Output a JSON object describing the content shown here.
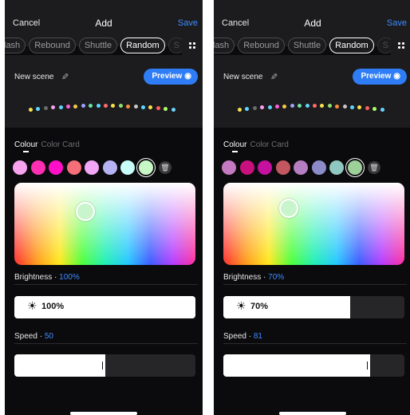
{
  "screens": [
    {
      "header": {
        "cancel": "Cancel",
        "title": "Add",
        "save": "Save"
      },
      "modes": [
        "lash",
        "Rebound",
        "Shuttle",
        "Random",
        "S"
      ],
      "active_mode": "Random",
      "scene": {
        "name": "New scene",
        "preview_label": "Preview"
      },
      "tabs": {
        "colour": "Colour",
        "color_card": "Color Card"
      },
      "swatches": [
        "#f7a3ef",
        "#ff2fb4",
        "#ff10c8",
        "#f56e78",
        "#f2a6f5",
        "#b6b3f5",
        "#c8fffa",
        "#c8f7c6"
      ],
      "selected_swatch": 7,
      "brightness": {
        "label": "Brightness",
        "value_text": "100%",
        "level": 1.0,
        "display": "100%"
      },
      "speed": {
        "label": "Speed",
        "value_text": "50",
        "level": 0.5
      }
    },
    {
      "header": {
        "cancel": "Cancel",
        "title": "Add",
        "save": "Save"
      },
      "modes": [
        "lash",
        "Rebound",
        "Shuttle",
        "Random",
        "S"
      ],
      "active_mode": "Random",
      "scene": {
        "name": "New scene",
        "preview_label": "Preview"
      },
      "tabs": {
        "colour": "Colour",
        "color_card": "Color Card"
      },
      "swatches": [
        "#c579c0",
        "#c8107f",
        "#c510a0",
        "#c35760",
        "#b57ec2",
        "#8a8bc8",
        "#8fc8c0",
        "#9ed09a"
      ],
      "selected_swatch": 7,
      "brightness": {
        "label": "Brightness",
        "value_text": "70%",
        "level": 0.7,
        "display": "70%"
      },
      "speed": {
        "label": "Speed",
        "value_text": "81",
        "level": 0.81
      }
    }
  ],
  "scene_dot_colors": [
    "#f9e14b",
    "#5ed7ff",
    "#6b6b6b",
    "#f8a3f0",
    "#5ed7ff",
    "#ff5edb",
    "#f7c948",
    "#a0a0ff",
    "#6be5a5",
    "#5ed7ff",
    "#ff6b6b",
    "#f9e14b",
    "#8fe36b",
    "#ff8a3d",
    "#c8c8c8",
    "#5ed7ff",
    "#f9e14b",
    "#ff5e5e",
    "#a8ff6b",
    "#6bd4ff"
  ]
}
